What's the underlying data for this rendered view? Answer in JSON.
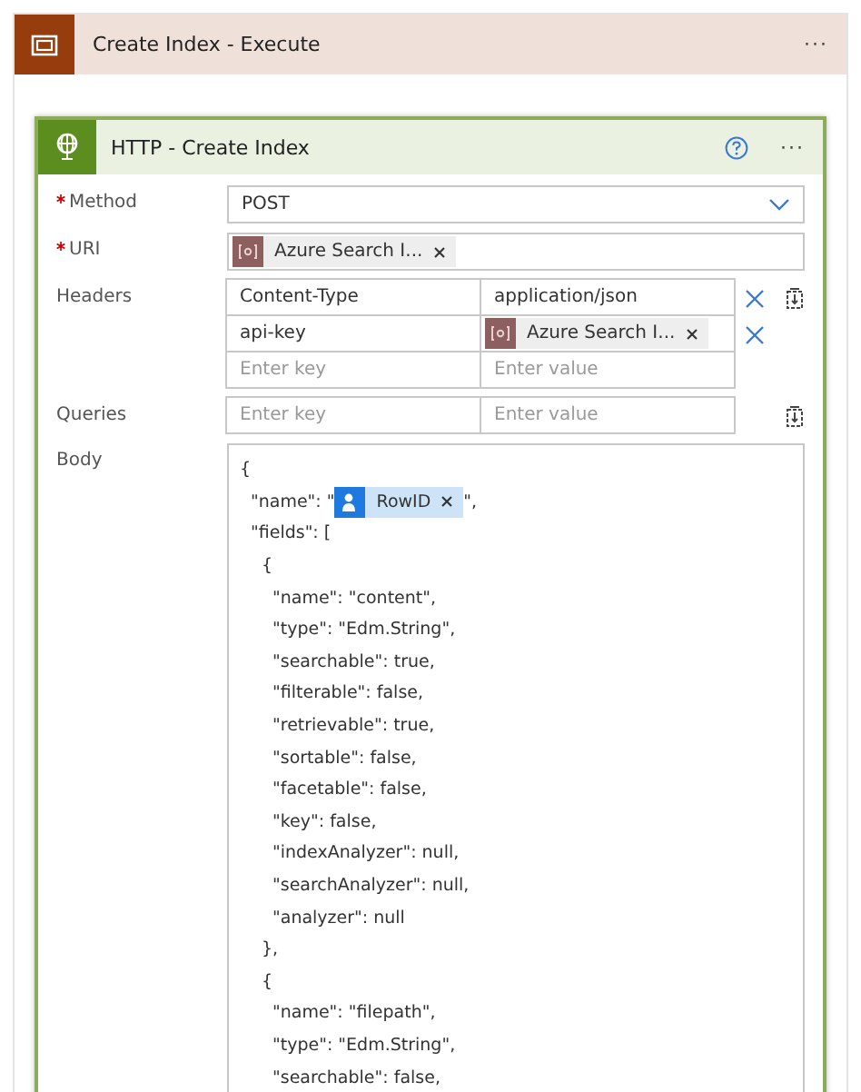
{
  "scope": {
    "title": "Create Index - Execute",
    "menu": "···"
  },
  "action": {
    "title": "HTTP - Create Index",
    "menu": "···",
    "method": {
      "label": "Method",
      "required": true,
      "value": "POST"
    },
    "uri": {
      "label": "URI",
      "required": true,
      "tokens": [
        {
          "kind": "variable",
          "label": "Azure Search I..."
        }
      ]
    },
    "headers": {
      "label": "Headers",
      "rows": [
        {
          "key": {
            "text": "Content-Type"
          },
          "value": {
            "text": "application/json"
          },
          "removable": true
        },
        {
          "key": {
            "text": "api-key"
          },
          "value": {
            "token": {
              "kind": "variable",
              "label": "Azure Search I..."
            }
          },
          "removable": true
        },
        {
          "key": {
            "placeholder": "Enter key"
          },
          "value": {
            "placeholder": "Enter value"
          },
          "removable": false
        }
      ]
    },
    "queries": {
      "label": "Queries",
      "rows": [
        {
          "key": {
            "placeholder": "Enter key"
          },
          "value": {
            "placeholder": "Enter value"
          },
          "removable": false
        }
      ]
    },
    "body": {
      "label": "Body",
      "lines": [
        {
          "parts": [
            {
              "kind": "text",
              "text": "{"
            }
          ],
          "children": [
            {
              "parts": [
                {
                  "kind": "text",
                  "text": "\"name\": \""
                },
                {
                  "kind": "user",
                  "label": "RowID"
                },
                {
                  "kind": "text",
                  "text": "\","
                }
              ]
            },
            {
              "parts": [
                {
                  "kind": "text",
                  "text": "\"fields\": ["
                }
              ],
              "children": [
                {
                  "parts": [
                    {
                      "kind": "text",
                      "text": "{"
                    }
                  ],
                  "children": [
                    {
                      "parts": [
                        {
                          "kind": "text",
                          "text": "\"name\": \"content\","
                        }
                      ]
                    },
                    {
                      "parts": [
                        {
                          "kind": "text",
                          "text": "\"type\": \"Edm.String\","
                        }
                      ]
                    },
                    {
                      "parts": [
                        {
                          "kind": "text",
                          "text": "\"searchable\": true,"
                        }
                      ]
                    },
                    {
                      "parts": [
                        {
                          "kind": "text",
                          "text": "\"filterable\": false,"
                        }
                      ]
                    },
                    {
                      "parts": [
                        {
                          "kind": "text",
                          "text": "\"retrievable\": true,"
                        }
                      ]
                    },
                    {
                      "parts": [
                        {
                          "kind": "text",
                          "text": "\"sortable\": false,"
                        }
                      ]
                    },
                    {
                      "parts": [
                        {
                          "kind": "text",
                          "text": "\"facetable\": false,"
                        }
                      ]
                    },
                    {
                      "parts": [
                        {
                          "kind": "text",
                          "text": "\"key\": false,"
                        }
                      ]
                    },
                    {
                      "parts": [
                        {
                          "kind": "text",
                          "text": "\"indexAnalyzer\": null,"
                        }
                      ]
                    },
                    {
                      "parts": [
                        {
                          "kind": "text",
                          "text": "\"searchAnalyzer\": null,"
                        }
                      ]
                    },
                    {
                      "parts": [
                        {
                          "kind": "text",
                          "text": "\"analyzer\": null"
                        }
                      ]
                    }
                  ]
                },
                {
                  "parts": [
                    {
                      "kind": "text",
                      "text": "},"
                    }
                  ]
                },
                {
                  "parts": [
                    {
                      "kind": "text",
                      "text": "{"
                    }
                  ],
                  "children": [
                    {
                      "parts": [
                        {
                          "kind": "text",
                          "text": "\"name\": \"filepath\","
                        }
                      ]
                    },
                    {
                      "parts": [
                        {
                          "kind": "text",
                          "text": "\"type\": \"Edm.String\","
                        }
                      ]
                    },
                    {
                      "parts": [
                        {
                          "kind": "text",
                          "text": "\"searchable\": false,"
                        }
                      ]
                    }
                  ]
                }
              ]
            }
          ]
        }
      ]
    }
  }
}
